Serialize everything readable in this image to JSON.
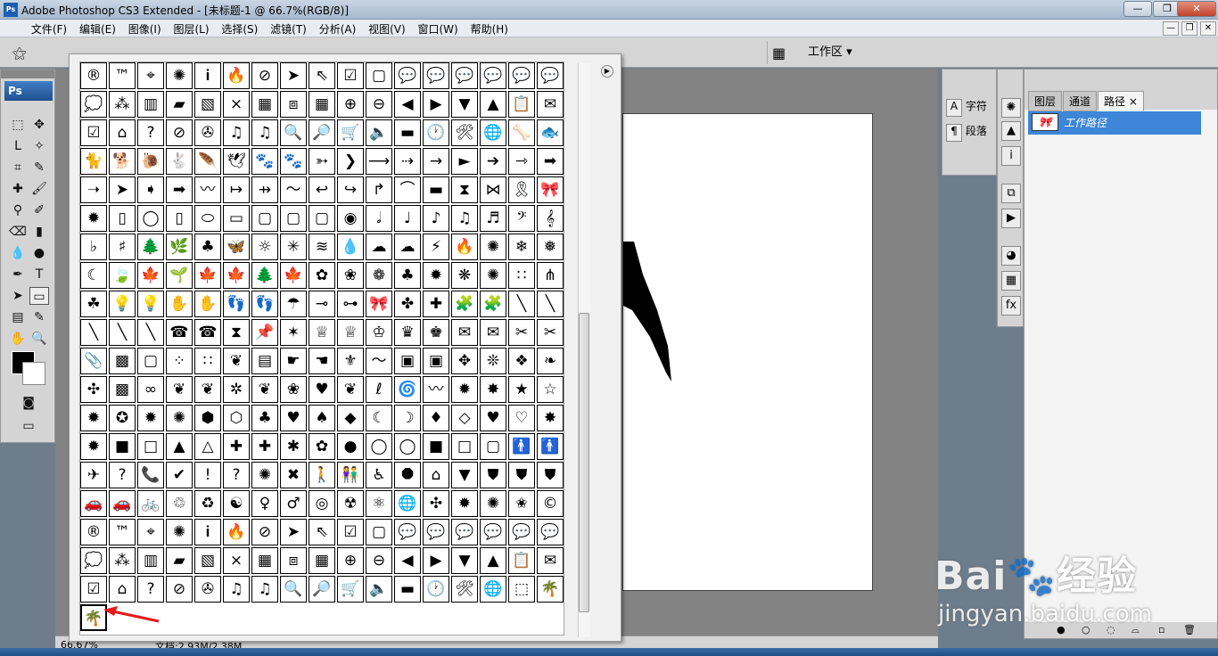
{
  "window": {
    "app_icon": "Ps",
    "title": "Adobe Photoshop CS3 Extended - [未标题-1 @ 66.7%(RGB/8)]",
    "controls": [
      "—",
      "❐",
      "✕"
    ]
  },
  "menubar": {
    "items": [
      "文件(F)",
      "编辑(E)",
      "图像(I)",
      "图层(L)",
      "选择(S)",
      "滤镜(T)",
      "分析(A)",
      "视图(V)",
      "窗口(W)",
      "帮助(H)"
    ],
    "doc_controls": [
      "—",
      "❐",
      "✕"
    ]
  },
  "options_bar": {
    "workspace_label": "工作区 ▾"
  },
  "toolbox": {
    "logo": "Ps"
  },
  "shape_picker": {
    "icons": [
      "®",
      "™",
      "⌖",
      "✺",
      "𝐢",
      "🔥",
      "⊘",
      "➤",
      "⇖",
      "☑",
      "▢",
      "💬",
      "💬",
      "💬",
      "💬",
      "💬",
      "💬",
      "💭",
      "⁂",
      "▥",
      "▰",
      "▧",
      "⨯",
      "▦",
      "⧈",
      "▦",
      "⊕",
      "⊖",
      "◀",
      "▶",
      "▼",
      "▲",
      "📋",
      "✉",
      "☑",
      "⌂",
      "?",
      "⊘",
      "✇",
      "♫",
      "♫",
      "🔍",
      "🔎",
      "🛒",
      "🔈",
      "▬",
      "🕐",
      "🛠",
      "🌐",
      "🦴",
      "🐟",
      "🐈",
      "🐕",
      "🐌",
      "🐇",
      "🪶",
      "🕊",
      "🐾",
      "🐾",
      "➳",
      "❯",
      "⟶",
      "⇢",
      "→",
      "►",
      "➔",
      "⇾",
      "➡",
      "➝",
      "➤",
      "➧",
      "➡",
      "〰",
      "↦",
      "⇸",
      "〜",
      "↩",
      "↪",
      "↱",
      "⌒",
      "▬",
      "⧗",
      "⋈",
      "🎗",
      "🎀",
      "✹",
      "▯",
      "◯",
      "▯",
      "⬭",
      "▭",
      "▢",
      "▢",
      "▢",
      "◉",
      "𝅗𝅥",
      "♩",
      "♪",
      "♫",
      "♬",
      "𝄢",
      "𝄞",
      "♭",
      "♯",
      "🌲",
      "🌿",
      "♣",
      "🦋",
      "☼",
      "✳",
      "≋",
      "💧",
      "☁",
      "☁",
      "⚡",
      "🔥",
      "✺",
      "❄",
      "❅",
      "☾",
      "🍃",
      "🍁",
      "🌱",
      "🍁",
      "🍁",
      "🌲",
      "🍁",
      "✿",
      "❀",
      "❁",
      "♣",
      "✹",
      "❋",
      "✺",
      "∷",
      "⋔",
      "☘",
      "💡",
      "💡",
      "✋",
      "✋",
      "👣",
      "👣",
      "☂",
      "⊸",
      "⊶",
      "🎀",
      "✤",
      "✚",
      "🧩",
      "🧩",
      "╲",
      "╲",
      "╲",
      "╲",
      "╲",
      "☎",
      "☎",
      "⧗",
      "📌",
      "✶",
      "♕",
      "♕",
      "♔",
      "♛",
      "♚",
      "✉",
      "✉",
      "✂",
      "✂",
      "📎",
      "▩",
      "▢",
      "⁘",
      "∷",
      "❦",
      "▤",
      "☛",
      "☚",
      "⚜",
      "〜",
      "▣",
      "▣",
      "✥",
      "❊",
      "❖",
      "❧",
      "✣",
      "▩",
      "∞",
      "❦",
      "❦",
      "✲",
      "❦",
      "❀",
      "♥",
      "❦",
      "ℓ",
      "🌀",
      "〰",
      "✹",
      "✸",
      "★",
      "☆",
      "✹",
      "✪",
      "✹",
      "✺",
      "⬢",
      "⬡",
      "♣",
      "♥",
      "♠",
      "◆",
      "☾",
      "☽",
      "♦",
      "◇",
      "♥",
      "♡",
      "✸",
      "✹",
      "■",
      "□",
      "▲",
      "△",
      "✚",
      "✚",
      "✱",
      "✿",
      "●",
      "◯",
      "◯",
      "■",
      "□",
      "▢",
      "🚹",
      "🚹",
      "✈",
      "?",
      "📞",
      "✔",
      "!",
      "?",
      "✺",
      "✖",
      "🚶",
      "👫",
      "♿",
      "⯃",
      "⌂",
      "▼",
      "⛊",
      "⛊",
      "⛊",
      "🚗",
      "🚗",
      "🚲",
      "♲",
      "♻",
      "☯",
      "♀",
      "♂",
      "◎",
      "☢",
      "⚛",
      "🌐",
      "✣",
      "✹",
      "✺",
      "✬",
      "©",
      "®",
      "™",
      "⌖",
      "✺",
      "𝐢",
      "🔥",
      "⊘",
      "➤",
      "⇖",
      "☑",
      "▢",
      "💬",
      "💬",
      "💬",
      "💬",
      "💬",
      "💬",
      "💭",
      "⁂",
      "▥",
      "▰",
      "▧",
      "⨯",
      "▦",
      "⧈",
      "▦",
      "⊕",
      "⊖",
      "◀",
      "▶",
      "▼",
      "▲",
      "📋",
      "✉",
      "☑",
      "⌂",
      "?",
      "⊘",
      "✇",
      "♫",
      "♫",
      "🔍",
      "🔎",
      "🛒",
      "🔈",
      "▬",
      "🕐",
      "🛠",
      "🌐",
      "⬚",
      "🌴",
      "🌴"
    ],
    "selected_index": 323
  },
  "status_bar": {
    "zoom": "66.67%",
    "doc_info": "文档:2.93M/2.38M"
  },
  "char_panel": {
    "character_label": "字符",
    "paragraph_label": "段落"
  },
  "paths_panel": {
    "tabs": [
      "图层",
      "通道",
      "路径"
    ],
    "active_tab": "路径",
    "path_name": "工作路径"
  },
  "watermark": {
    "brand": "Bai🐾经验",
    "url": "jingyan.baidu.com"
  }
}
